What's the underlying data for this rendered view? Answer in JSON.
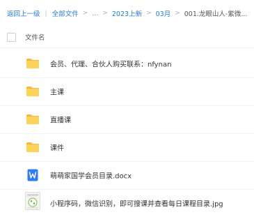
{
  "breadcrumb": {
    "back": "返回上一级",
    "root": "全部文件",
    "ellipsis": "...",
    "level1": "2023上新",
    "level2": "03月",
    "current": "001.龙眼山人-紫微..."
  },
  "header": {
    "column_name": "文件名"
  },
  "files": [
    {
      "name": "会员、代理、合伙人购买联系：nfynan",
      "icon": "folder-icon"
    },
    {
      "name": "主课",
      "icon": "folder-icon"
    },
    {
      "name": "直播课",
      "icon": "folder-icon"
    },
    {
      "name": "课件",
      "icon": "folder-icon"
    },
    {
      "name": "萌萌家国学会员目录.docx",
      "icon": "word-doc-icon"
    },
    {
      "name": "小程序码，微信识别，即可搜课并查看每日课程目录.jpg",
      "icon": "image-thumbnail-icon"
    }
  ],
  "colors": {
    "accent": "#1f7ee0",
    "folder": "#f7c948",
    "word": "#2f7cf6"
  }
}
